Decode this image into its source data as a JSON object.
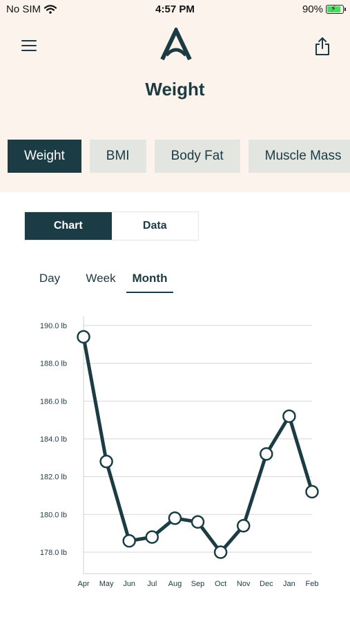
{
  "status_bar": {
    "carrier": "No SIM",
    "time": "4:57 PM",
    "battery": "90%",
    "battery_level": 0.9
  },
  "header": {
    "menu_icon": "hamburger-menu-icon",
    "logo_icon": "app-logo-a-icon",
    "share_icon": "share-icon",
    "title": "Weight"
  },
  "metric_tabs": [
    {
      "label": "Weight",
      "active": true
    },
    {
      "label": "BMI",
      "active": false
    },
    {
      "label": "Body Fat",
      "active": false
    },
    {
      "label": "Muscle Mass",
      "active": false
    }
  ],
  "view_toggle": [
    {
      "label": "Chart",
      "active": true
    },
    {
      "label": "Data",
      "active": false
    }
  ],
  "period_tabs": [
    {
      "label": "Day",
      "active": false
    },
    {
      "label": "Week",
      "active": false
    },
    {
      "label": "Month",
      "active": true
    }
  ],
  "colors": {
    "brand": "#1b3c45",
    "header_bg": "#fcf4ec",
    "tab_inactive_bg": "#e3e5e1"
  },
  "chart_data": {
    "type": "line",
    "title": "",
    "xlabel": "",
    "ylabel": "",
    "categories": [
      "Apr",
      "May",
      "Jun",
      "Jul",
      "Aug",
      "Sep",
      "Oct",
      "Nov",
      "Dec",
      "Jan",
      "Feb"
    ],
    "series": [
      {
        "values": [
          189.4,
          182.8,
          178.6,
          178.8,
          179.8,
          179.6,
          178.0,
          179.4,
          183.2,
          185.2,
          181.2
        ]
      }
    ],
    "y_ticks": [
      "190.0 lb",
      "188.0 lb",
      "186.0 lb",
      "184.0 lb",
      "182.0 lb",
      "180.0 lb",
      "178.0 lb"
    ],
    "y_tick_values": [
      190,
      188,
      186,
      184,
      182,
      180,
      178
    ],
    "ylim": [
      177.0,
      190.0
    ],
    "grid": true,
    "legend": "none"
  }
}
